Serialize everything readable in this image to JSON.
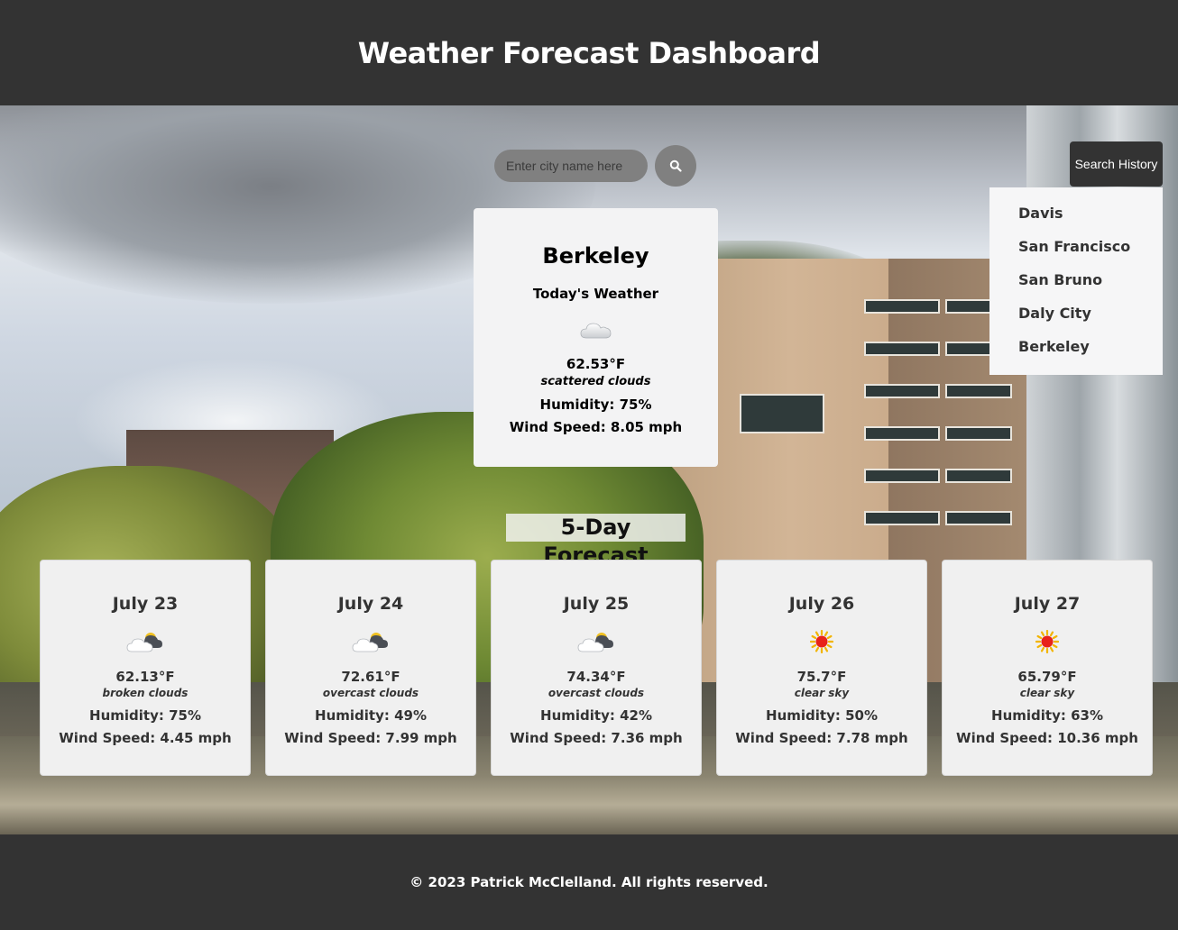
{
  "header": {
    "title": "Weather Forecast Dashboard"
  },
  "search": {
    "placeholder": "Enter city name here",
    "button_icon": "search-icon"
  },
  "history": {
    "button_label": "Search History",
    "items": [
      "Davis",
      "San Francisco",
      "San Bruno",
      "Daly City",
      "Berkeley"
    ]
  },
  "today": {
    "city": "Berkeley",
    "label": "Today's Weather",
    "icon": "cloud-icon",
    "temp": "62.53°F",
    "description": "scattered clouds",
    "humidity": "Humidity: 75%",
    "wind": "Wind Speed: 8.05 mph"
  },
  "forecast": {
    "title": "5-Day Forecast",
    "days": [
      {
        "date": "July 23",
        "icon": "sun-behind-cloud-icon",
        "temp": "62.13°F",
        "description": "broken clouds",
        "humidity": "Humidity: 75%",
        "wind": "Wind Speed: 4.45 mph"
      },
      {
        "date": "July 24",
        "icon": "sun-behind-cloud-icon",
        "temp": "72.61°F",
        "description": "overcast clouds",
        "humidity": "Humidity: 49%",
        "wind": "Wind Speed: 7.99 mph"
      },
      {
        "date": "July 25",
        "icon": "sun-behind-cloud-icon",
        "temp": "74.34°F",
        "description": "overcast clouds",
        "humidity": "Humidity: 42%",
        "wind": "Wind Speed: 7.36 mph"
      },
      {
        "date": "July 26",
        "icon": "sun-icon",
        "temp": "75.7°F",
        "description": "clear sky",
        "humidity": "Humidity: 50%",
        "wind": "Wind Speed: 7.78 mph"
      },
      {
        "date": "July 27",
        "icon": "sun-icon",
        "temp": "65.79°F",
        "description": "clear sky",
        "humidity": "Humidity: 63%",
        "wind": "Wind Speed: 10.36 mph"
      }
    ]
  },
  "footer": {
    "text": "© 2023 Patrick McClelland. All rights reserved."
  },
  "colors": {
    "header_bg": "#333333",
    "card_bg": "#f0f0f0",
    "search_bg": "#808080"
  }
}
